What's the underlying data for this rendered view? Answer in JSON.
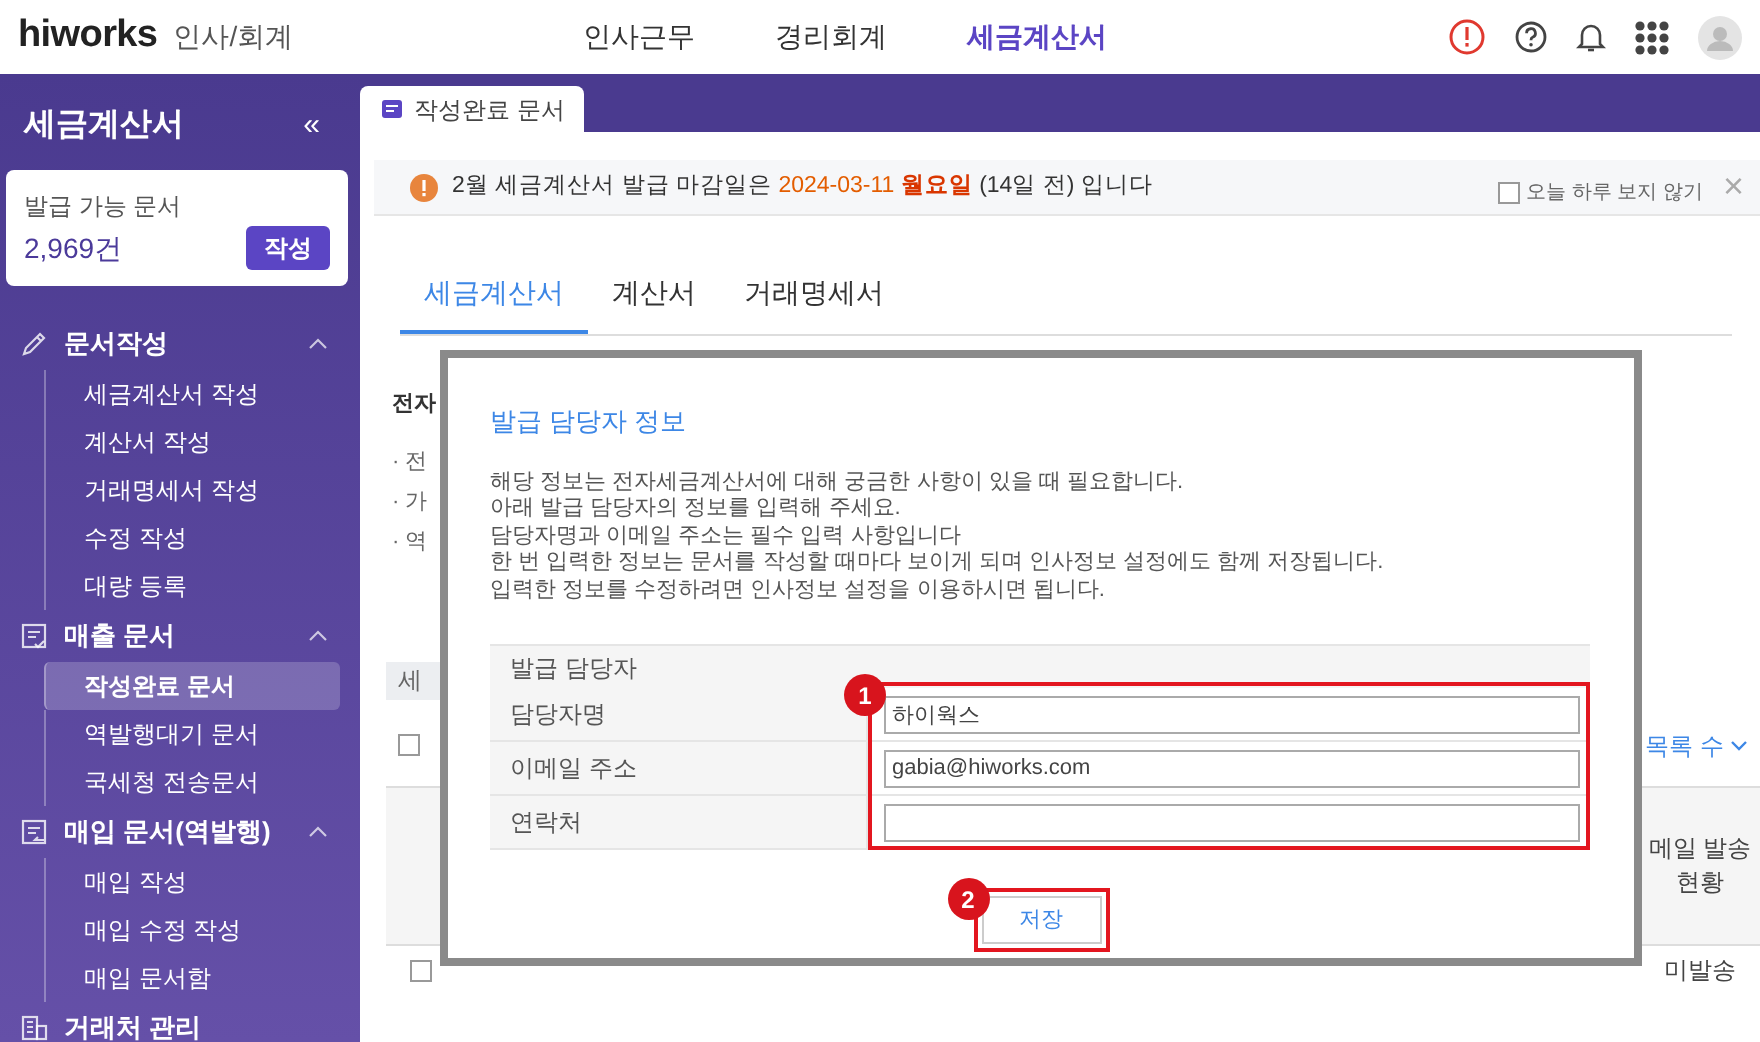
{
  "header": {
    "logo": "hiworks",
    "product": "인사/회계",
    "nav": [
      {
        "label": "인사근무",
        "selected": false
      },
      {
        "label": "경리회계",
        "selected": false
      },
      {
        "label": "세금계산서",
        "selected": true
      }
    ]
  },
  "sidebar": {
    "title": "세금계산서",
    "collapse": "«",
    "summary": {
      "label": "발급 가능 문서",
      "count": "2,969건",
      "button": "작성"
    },
    "groups": [
      {
        "label": "문서작성",
        "expanded": true,
        "children": [
          {
            "label": "세금계산서 작성",
            "selected": false
          },
          {
            "label": "계산서 작성",
            "selected": false
          },
          {
            "label": "거래명세서 작성",
            "selected": false
          },
          {
            "label": "수정 작성",
            "selected": false
          },
          {
            "label": "대량 등록",
            "selected": false
          }
        ]
      },
      {
        "label": "매출 문서",
        "expanded": true,
        "children": [
          {
            "label": "작성완료 문서",
            "selected": true
          },
          {
            "label": "역발행대기 문서",
            "selected": false
          },
          {
            "label": "국세청 전송문서",
            "selected": false
          }
        ]
      },
      {
        "label": "매입 문서(역발행)",
        "expanded": true,
        "children": [
          {
            "label": "매입 작성",
            "selected": false
          },
          {
            "label": "매입 수정 작성",
            "selected": false
          },
          {
            "label": "매입 문서함",
            "selected": false
          }
        ]
      },
      {
        "label": "거래처 관리",
        "expanded": false
      }
    ]
  },
  "page_tabs": [
    {
      "label": "작성완료 문서",
      "selected": true
    }
  ],
  "notice": {
    "parts": [
      {
        "kind": "plain",
        "text": "2월 세금계산서 발급 마감일은"
      },
      {
        "kind": "date",
        "text": "2024-03-11"
      },
      {
        "kind": "weekday",
        "text": "월요일"
      },
      {
        "kind": "plain",
        "text": "(14일 전) 입니다"
      }
    ],
    "dismiss": {
      "label": "오늘 하루 보지 않기",
      "checked": false
    },
    "close": "×"
  },
  "doc_tabs": [
    {
      "label": "세금계산서",
      "selected": true
    },
    {
      "label": "계산서",
      "selected": false
    },
    {
      "label": "거래명세서",
      "selected": false
    }
  ],
  "background": {
    "heading": "전자",
    "bullets": [
      "· 전",
      "· 가",
      "· 역"
    ],
    "filter_tab": "세",
    "list_count": "목록 수",
    "columns": [
      "메일 발송 현황"
    ],
    "rows": [
      {
        "checked": false,
        "cells": [
          "미발송"
        ]
      }
    ],
    "select_all": false
  },
  "dialog": {
    "title": "발급 담당자 정보",
    "lines": [
      "해당 정보는 전자세금계산서에 대해 궁금한 사항이 있을 때 필요합니다.",
      "아래 발급 담당자의 정보를 입력해 주세요.",
      "담당자명과 이메일 주소는 필수 입력 사항입니다",
      "한 번 입력한 정보는 문서를 작성할 때마다 보이게 되며 인사정보 설정에도 함께 저장됩니다.",
      "입력한 정보를 수정하려면 인사정보 설정을 이용하시면 됩니다."
    ],
    "section": "발급 담당자",
    "fields": [
      {
        "label": "담당자명",
        "value": "하이웍스"
      },
      {
        "label": "이메일 주소",
        "value": "gabia@hiworks.com"
      },
      {
        "label": "연락처"
      }
    ],
    "save": "저장"
  },
  "annotations": [
    {
      "number": "1"
    },
    {
      "number": "2"
    }
  ]
}
